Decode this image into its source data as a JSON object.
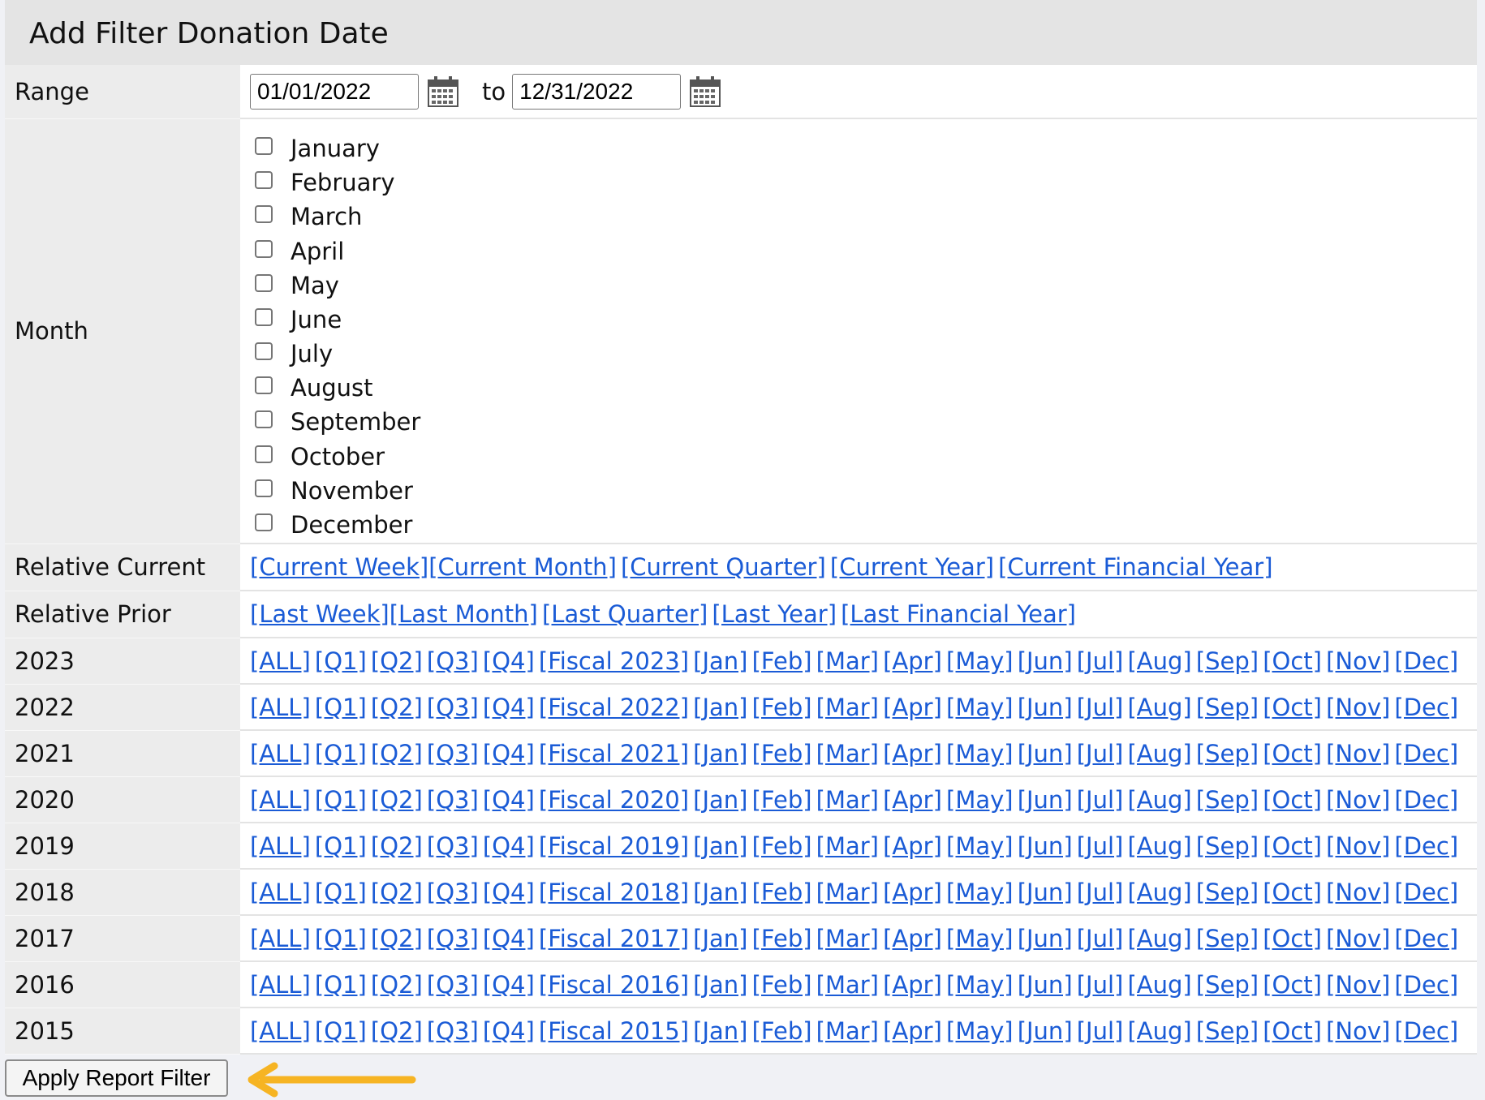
{
  "title": "Add Filter Donation Date",
  "range": {
    "label": "Range",
    "from_value": "01/01/2022",
    "to_label": "to",
    "to_value": "12/31/2022"
  },
  "month": {
    "label": "Month",
    "options": [
      "January",
      "February",
      "March",
      "April",
      "May",
      "June",
      "July",
      "August",
      "September",
      "October",
      "November",
      "December"
    ]
  },
  "relative_current": {
    "label": "Relative Current",
    "links": [
      "[Current Week]",
      "[Current Month]",
      "[Current Quarter]",
      "[Current Year]",
      "[Current Financial Year]"
    ]
  },
  "relative_prior": {
    "label": "Relative Prior",
    "links": [
      "[Last Week]",
      "[Last Month]",
      "[Last Quarter]",
      "[Last Year]",
      "[Last Financial Year]"
    ]
  },
  "years": [
    {
      "year": "2023",
      "links": [
        "[ALL]",
        "[Q1]",
        "[Q2]",
        "[Q3]",
        "[Q4]",
        "[Fiscal 2023]",
        "[Jan]",
        "[Feb]",
        "[Mar]",
        "[Apr]",
        "[May]",
        "[Jun]",
        "[Jul]",
        "[Aug]",
        "[Sep]",
        "[Oct]",
        "[Nov]",
        "[Dec]"
      ]
    },
    {
      "year": "2022",
      "links": [
        "[ALL]",
        "[Q1]",
        "[Q2]",
        "[Q3]",
        "[Q4]",
        "[Fiscal 2022]",
        "[Jan]",
        "[Feb]",
        "[Mar]",
        "[Apr]",
        "[May]",
        "[Jun]",
        "[Jul]",
        "[Aug]",
        "[Sep]",
        "[Oct]",
        "[Nov]",
        "[Dec]"
      ]
    },
    {
      "year": "2021",
      "links": [
        "[ALL]",
        "[Q1]",
        "[Q2]",
        "[Q3]",
        "[Q4]",
        "[Fiscal 2021]",
        "[Jan]",
        "[Feb]",
        "[Mar]",
        "[Apr]",
        "[May]",
        "[Jun]",
        "[Jul]",
        "[Aug]",
        "[Sep]",
        "[Oct]",
        "[Nov]",
        "[Dec]"
      ]
    },
    {
      "year": "2020",
      "links": [
        "[ALL]",
        "[Q1]",
        "[Q2]",
        "[Q3]",
        "[Q4]",
        "[Fiscal 2020]",
        "[Jan]",
        "[Feb]",
        "[Mar]",
        "[Apr]",
        "[May]",
        "[Jun]",
        "[Jul]",
        "[Aug]",
        "[Sep]",
        "[Oct]",
        "[Nov]",
        "[Dec]"
      ]
    },
    {
      "year": "2019",
      "links": [
        "[ALL]",
        "[Q1]",
        "[Q2]",
        "[Q3]",
        "[Q4]",
        "[Fiscal 2019]",
        "[Jan]",
        "[Feb]",
        "[Mar]",
        "[Apr]",
        "[May]",
        "[Jun]",
        "[Jul]",
        "[Aug]",
        "[Sep]",
        "[Oct]",
        "[Nov]",
        "[Dec]"
      ]
    },
    {
      "year": "2018",
      "links": [
        "[ALL]",
        "[Q1]",
        "[Q2]",
        "[Q3]",
        "[Q4]",
        "[Fiscal 2018]",
        "[Jan]",
        "[Feb]",
        "[Mar]",
        "[Apr]",
        "[May]",
        "[Jun]",
        "[Jul]",
        "[Aug]",
        "[Sep]",
        "[Oct]",
        "[Nov]",
        "[Dec]"
      ]
    },
    {
      "year": "2017",
      "links": [
        "[ALL]",
        "[Q1]",
        "[Q2]",
        "[Q3]",
        "[Q4]",
        "[Fiscal 2017]",
        "[Jan]",
        "[Feb]",
        "[Mar]",
        "[Apr]",
        "[May]",
        "[Jun]",
        "[Jul]",
        "[Aug]",
        "[Sep]",
        "[Oct]",
        "[Nov]",
        "[Dec]"
      ]
    },
    {
      "year": "2016",
      "links": [
        "[ALL]",
        "[Q1]",
        "[Q2]",
        "[Q3]",
        "[Q4]",
        "[Fiscal 2016]",
        "[Jan]",
        "[Feb]",
        "[Mar]",
        "[Apr]",
        "[May]",
        "[Jun]",
        "[Jul]",
        "[Aug]",
        "[Sep]",
        "[Oct]",
        "[Nov]",
        "[Dec]"
      ]
    },
    {
      "year": "2015",
      "links": [
        "[ALL]",
        "[Q1]",
        "[Q2]",
        "[Q3]",
        "[Q4]",
        "[Fiscal 2015]",
        "[Jan]",
        "[Feb]",
        "[Mar]",
        "[Apr]",
        "[May]",
        "[Jun]",
        "[Jul]",
        "[Aug]",
        "[Sep]",
        "[Oct]",
        "[Nov]",
        "[Dec]"
      ]
    }
  ],
  "apply_button": "Apply Report Filter",
  "colors": {
    "link": "#1a5bd6",
    "arrow": "#f6b423",
    "label_bg": "#ececec"
  },
  "icons": {
    "calendar": "calendar-icon",
    "arrow": "left-arrow-icon"
  }
}
